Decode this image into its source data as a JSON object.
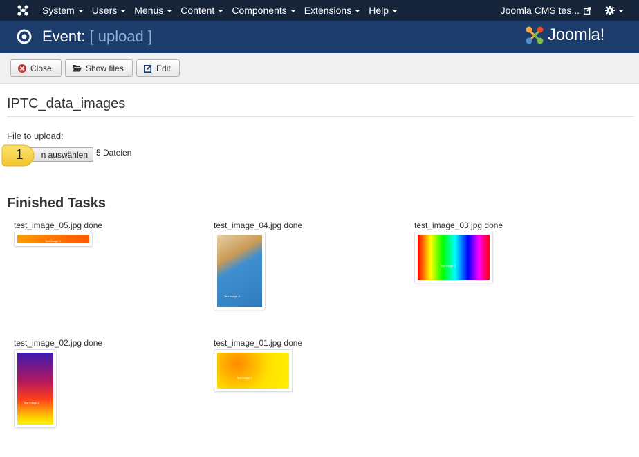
{
  "navbar": {
    "menu": [
      {
        "label": "System"
      },
      {
        "label": "Users"
      },
      {
        "label": "Menus"
      },
      {
        "label": "Content"
      },
      {
        "label": "Components"
      },
      {
        "label": "Extensions"
      },
      {
        "label": "Help"
      }
    ],
    "site_link": "Joomla CMS tes...",
    "logo_icon": "joomla-logo-icon",
    "gear_icon": "gear-icon"
  },
  "header": {
    "prefix": "Event:",
    "subtitle": "[ upload ]",
    "brand": "Joomla!"
  },
  "toolbar": {
    "close_label": "Close",
    "show_files_label": "Show files",
    "edit_label": "Edit"
  },
  "content": {
    "title": "IPTC_data_images",
    "file_label": "File to upload:",
    "file_button": "n auswählen",
    "file_count": "5 Dateien",
    "callout_number": "1",
    "finished_title": "Finished Tasks",
    "tasks": [
      {
        "label": "test_image_05.jpg done",
        "caption": "Test image 5"
      },
      {
        "label": "test_image_04.jpg done",
        "caption": "Test image 4"
      },
      {
        "label": "test_image_03.jpg done",
        "caption": "Test image 3"
      },
      {
        "label": "test_image_02.jpg done",
        "caption": "Test image 2"
      },
      {
        "label": "test_image_01.jpg done",
        "caption": "Test image 1"
      }
    ]
  },
  "colors": {
    "navbar": "#17253b",
    "header": "#1c3d6c",
    "callout": "#f6d440"
  }
}
